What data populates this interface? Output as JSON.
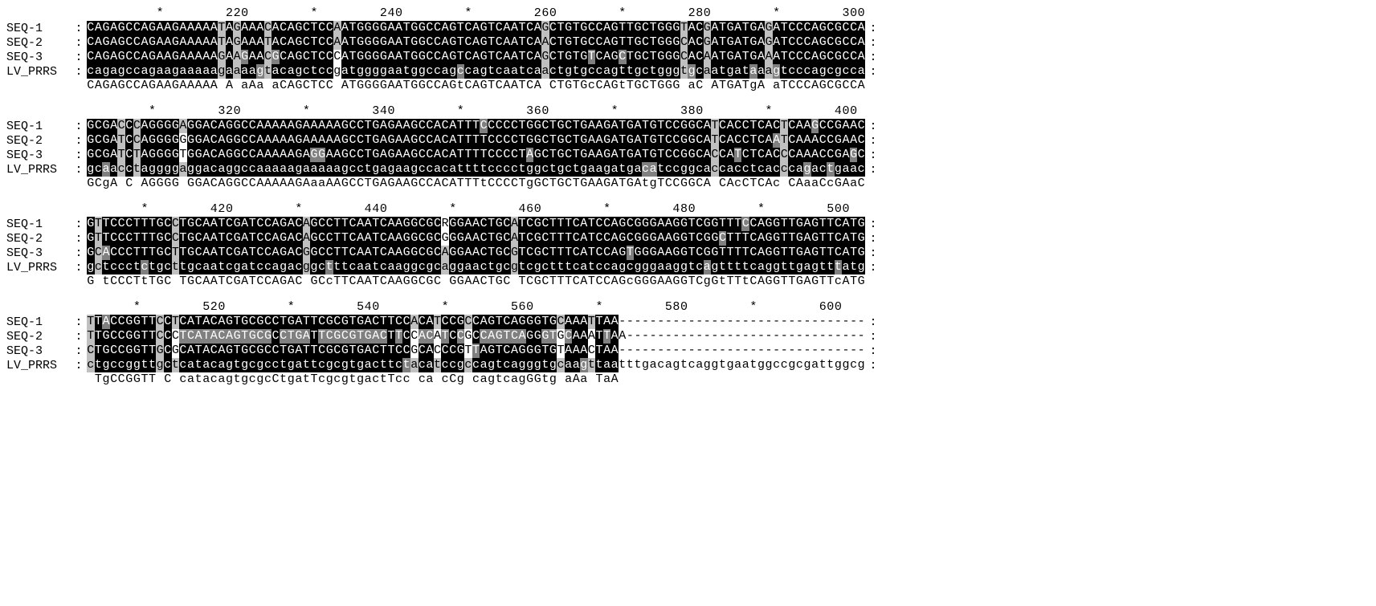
{
  "labels": [
    "SEQ-1",
    "SEQ-2",
    "SEQ-3",
    "LV_PRRS"
  ],
  "blocks": [
    {
      "start": 201,
      "len": 104,
      "ruler_marks": {},
      "seqs": [
        "CAGAGCCAGAAGAAAAATAGAAACACAGCTCCAATGGGGAATGGCCAGTCAGTCAATCAGCTGTGCCAGTTGCTGGGTACGATGATGAGATCCCAGCGCCA",
        "CAGAGCCAGAAGAAAAATAGAAATACAGCTCCAATGGGGAATGGCCAGTCAGTCAATCAACTGTGCCAGTTGCTGGGCACGATGATGAGATCCCAGCGCCA",
        "CAGAGCCAGAAGAAAAAGAAGAACGCAGCTCCCATGGGGAATGGCCAGTCAGTCAATCAGCTGTGTCAGCTGCTGGGCACAATGATGAAATCCCAGCGCCA",
        "cagagccagaagaaaaagaaaagtacagctccgatggggaatggccagccagtcaatcaactgtgccagttgctgggtgcaatgataaagtcccagcgcca"
      ]
    },
    {
      "start": 302,
      "len": 104,
      "ruler_marks": {
        "320": 320,
        "340": 340,
        "360": 360,
        "380": 380,
        "400": 400
      },
      "seqs": [
        "GCGACCCAGGGGAGGACAGGCCAAAAAGAAAAAGCCTGAGAAGCCACATTTCCCCCTGGCTGCTGAAGATGATGTCCGGCATCACCTCACTCAAGCCGAAC",
        "GCGATCCAGGGGGGGACAGGCCAAAAAGAAAAAGCCTGAGAAGCCACATTTTCCCCTGGCTGCTGAAGATGATGTCCGGCATCACCTCAATCAAACCGAAC",
        "GCGATCTAGGGGTGGACAGGCCAAAAAGAGGAAGCCTGAGAAGCCACATTTTCCCCTAGCTGCTGAAGATGATGTCCGGCACCATCTCACCCAAACCGAGC",
        "gcaacctaggggaggacaggccaaaaagaaaaagcctgagaagccacattttcccctggctgctgaagatgacatccggcaccacctcacccagactgaac"
      ]
    },
    {
      "start": 403,
      "len": 104,
      "ruler_marks": {
        "420": 420,
        "440": 440,
        "460": 460,
        "480": 480,
        "500": 500
      },
      "seqs": [
        "GTTCCCTTTGCCTGCAATCGATCCAGACAGCCTTCAATCAAGGCGCRGGAACTGCATCGCTTTCATCCAGCGGGAAGGTCGGTTTCCAGGTTGAGTTCATG",
        "GTTCCCTTTGCCTGCAATCGATCCAGACAGCCTTCAATCAAGGCGCGGGAACTGCATCGCTTTCATCCAGCGGGAAGGTCGGCTTTCAGGTTGAGTTCATG",
        "GCACCCTTTGCTTGCAATCGATCCAGACGGCCTTCAATCAAGGCGCAGGAACTGCGTCGCTTTCATCCAGTGGGAAGGTCGGTTTTCAGGTTGAGTTCATG",
        "gctccctctgcttgcaatcgatccagacggctttcaatcaaggcgcaggaactgcgtcgctttcatccagcgggaaggtcagttttcaggttgagtttatg"
      ]
    },
    {
      "start": 504,
      "len": 104,
      "ruler_marks": {
        "520": 520,
        "540": 540,
        "560": 560,
        "580": 580,
        "600": 600
      },
      "seqs": [
        "TTACCGGTTCCTCATACAGTGCGCCTGATTCGCGTGACTTCCACATCCGCCAGTCAGGGTGCAAATTAA--------------------------------",
        "TTGCCGGTTCCCTCATACAGTGCGCCTGATTCGCGTGACTTCCACATCCGCCAGTCAGGGTGCAAATTAA-------------------------------",
        "CTGCCGGTTGCGCATACAGTGCGCCTGATTCGCGTGACTTCCGCACCCGTTAGTCAGGGTGTAAACTAA--------------------------------",
        "ctgccggttgctcatacagtgcgcctgattcgcgtgacttctacatccgccagtcagggtgcaagttaatttgacagtcaggtgaatggccgcgattggcg"
      ]
    }
  ],
  "consensus_rule": "Majority-derived consensus line shown beneath each block; uppercase = 4/4 identity, lowercase = 3/4 identity, space = ≤2/4."
}
